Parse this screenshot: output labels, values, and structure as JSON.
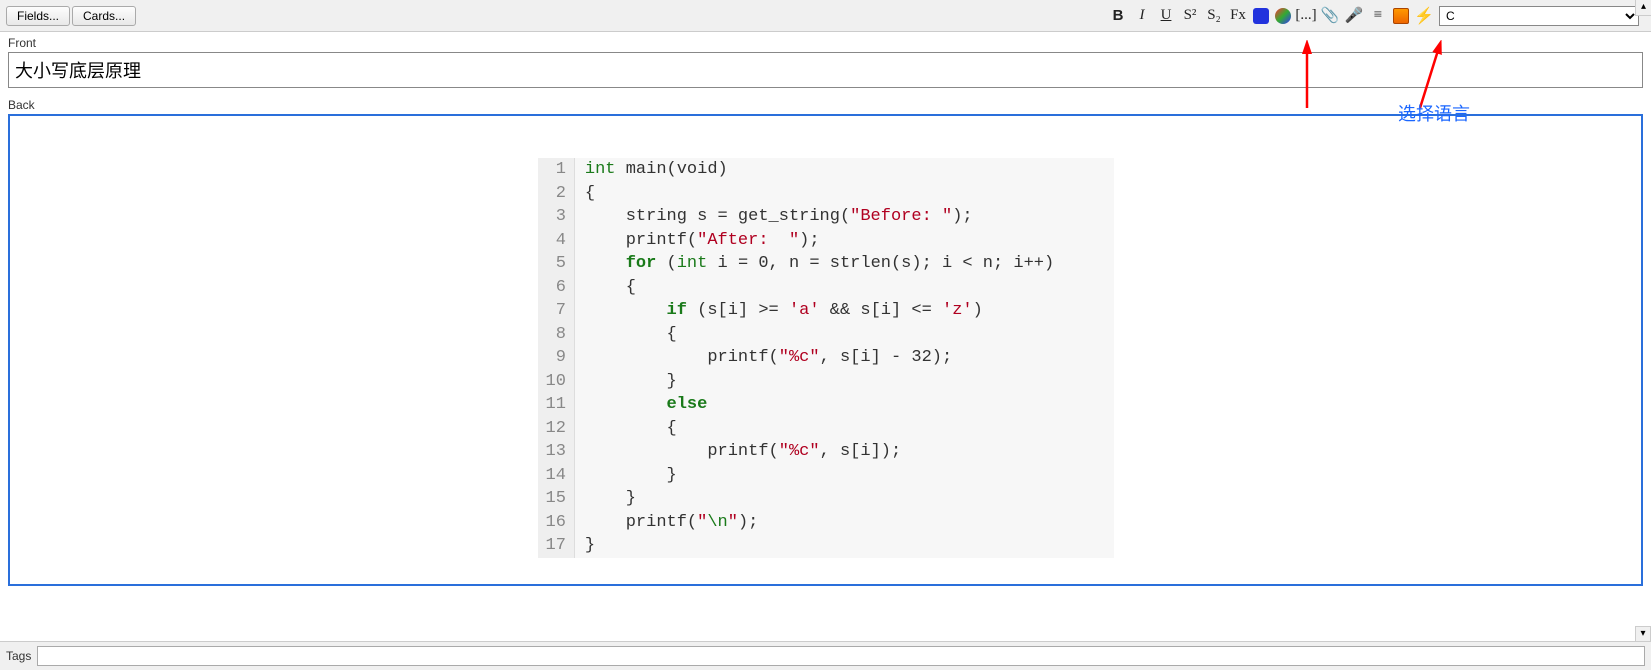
{
  "buttons": {
    "fields": "Fields...",
    "cards": "Cards..."
  },
  "toolbar": {
    "bold": "B",
    "italic": "I",
    "underline": "U",
    "sup": "S²",
    "sub": "S₂",
    "erase": "Fx",
    "cloze": "[...]",
    "attach": "📎",
    "mic": "🎤",
    "more": "≡",
    "language_selected": "C"
  },
  "labels": {
    "front": "Front",
    "back": "Back",
    "tags": "Tags"
  },
  "front_value": "大小写底层原理",
  "tags_value": "",
  "annotation": "选择语言",
  "code": {
    "line_numbers": [
      "1",
      "2",
      "3",
      "4",
      "5",
      "6",
      "7",
      "8",
      "9",
      "10",
      "11",
      "12",
      "13",
      "14",
      "15",
      "16",
      "17"
    ],
    "l1_type": "int",
    "l1_rest": " main(void)",
    "l2": "{",
    "l3_a": "    string s = get_string(",
    "l3_str": "\"Before: \"",
    "l3_b": ");",
    "l4_a": "    printf(",
    "l4_str": "\"After:  \"",
    "l4_b": ");",
    "l5_kw": "for",
    "l5_a": " (",
    "l5_type": "int",
    "l5_b": " i = 0, n = strlen(s); i < n; i++)",
    "l6": "    {",
    "l7_kw": "if",
    "l7_a": " (s[i] >= ",
    "l7_s1": "'a'",
    "l7_b": " && s[i] <= ",
    "l7_s2": "'z'",
    "l7_c": ")",
    "l8": "        {",
    "l9_a": "            printf(",
    "l9_str": "\"%c\"",
    "l9_b": ", s[i] - 32);",
    "l10": "        }",
    "l11_kw": "else",
    "l12": "        {",
    "l13_a": "            printf(",
    "l13_str": "\"%c\"",
    "l13_b": ", s[i]);",
    "l14": "        }",
    "l15": "    }",
    "l16_a": "    printf(",
    "l16_s1": "\"",
    "l16_esc": "\\n",
    "l16_s2": "\"",
    "l16_b": ");",
    "l17": "}"
  }
}
